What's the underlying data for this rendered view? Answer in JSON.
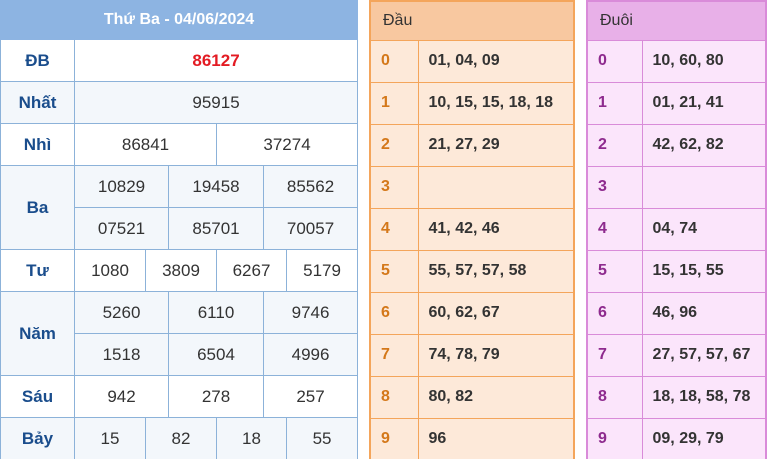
{
  "header": {
    "title": "Thứ Ba - 04/06/2024"
  },
  "prizes": {
    "db": {
      "label": "ĐB",
      "values": [
        "86127"
      ]
    },
    "nhat": {
      "label": "Nhất",
      "values": [
        "95915"
      ]
    },
    "nhi": {
      "label": "Nhì",
      "values": [
        "86841",
        "37274"
      ]
    },
    "ba": {
      "label": "Ba",
      "values": [
        "10829",
        "19458",
        "85562",
        "07521",
        "85701",
        "70057"
      ]
    },
    "tu": {
      "label": "Tư",
      "values": [
        "1080",
        "3809",
        "6267",
        "5179"
      ]
    },
    "nam": {
      "label": "Năm",
      "values": [
        "5260",
        "6110",
        "9746",
        "1518",
        "6504",
        "4996"
      ]
    },
    "sau": {
      "label": "Sáu",
      "values": [
        "942",
        "278",
        "257"
      ]
    },
    "bay": {
      "label": "Bảy",
      "values": [
        "15",
        "82",
        "18",
        "55"
      ]
    }
  },
  "dau": {
    "header": "Đầu",
    "rows": [
      {
        "key": "0",
        "values": "01, 04, 09"
      },
      {
        "key": "1",
        "values": "10, 15, 15, 18, 18"
      },
      {
        "key": "2",
        "values": "21, 27, 29"
      },
      {
        "key": "3",
        "values": ""
      },
      {
        "key": "4",
        "values": "41, 42, 46"
      },
      {
        "key": "5",
        "values": "55, 57, 57, 58"
      },
      {
        "key": "6",
        "values": "60, 62, 67"
      },
      {
        "key": "7",
        "values": "74, 78, 79"
      },
      {
        "key": "8",
        "values": "80, 82"
      },
      {
        "key": "9",
        "values": "96"
      }
    ]
  },
  "duoi": {
    "header": "Đuôi",
    "rows": [
      {
        "key": "0",
        "values": "10, 60, 80"
      },
      {
        "key": "1",
        "values": "01, 21, 41"
      },
      {
        "key": "2",
        "values": "42, 62, 82"
      },
      {
        "key": "3",
        "values": ""
      },
      {
        "key": "4",
        "values": "04, 74"
      },
      {
        "key": "5",
        "values": "15, 15, 55"
      },
      {
        "key": "6",
        "values": "46, 96"
      },
      {
        "key": "7",
        "values": "27, 57, 57, 67"
      },
      {
        "key": "8",
        "values": "18, 18, 58, 78"
      },
      {
        "key": "9",
        "values": "09, 29, 79"
      }
    ]
  },
  "colors": {
    "header_blue": "#8db4e2",
    "special_red": "#e31b23",
    "dau_orange": "#f4a55b",
    "duoi_purple": "#d98bd9"
  }
}
